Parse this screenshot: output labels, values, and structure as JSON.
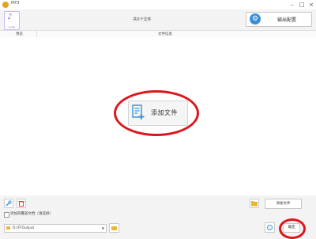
{
  "window": {
    "title": "MP3",
    "controls": [
      "minimize-icon",
      "maximize-icon",
      "close-icon"
    ]
  },
  "header": {
    "format_icon_label": "Audio",
    "file_count": "共0个文件",
    "output_config_label": "输出配置"
  },
  "file_list": {
    "columns": [
      "预览",
      "文件信息"
    ],
    "add_file_label": "添加文件"
  },
  "footer": {
    "add_file_label": "添加文件",
    "merge_checkbox_label": "添加到覆盖文档（请选择）",
    "merge_checked": false,
    "output_path": "D:\\FFOutput",
    "ok_label": "确定"
  },
  "annotations": {
    "highlight_color": "#e0141b"
  },
  "colors": {
    "accent": "#3a90d8",
    "folder": "#e9b62f",
    "audio_icon": "#8a63d2"
  }
}
